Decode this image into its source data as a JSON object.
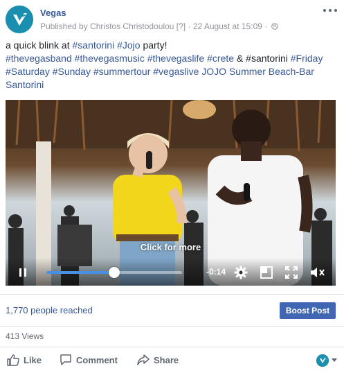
{
  "post": {
    "page_name": "Vegas",
    "published_prefix": "Published by",
    "author": "Christos Christodoulou",
    "author_badge": "[?]",
    "separator": "·",
    "date": "22 August at 15:09",
    "privacy_icon": "globe-icon",
    "text_parts": [
      {
        "text": "a quick blink at ",
        "tag": false
      },
      {
        "text": "#santorini",
        "tag": true
      },
      {
        "text": " ",
        "tag": false
      },
      {
        "text": "#Jojo",
        "tag": true
      },
      {
        "text": " party!",
        "tag": false
      },
      {
        "text": "\n",
        "tag": false
      },
      {
        "text": "#thevegasband",
        "tag": true
      },
      {
        "text": " ",
        "tag": false
      },
      {
        "text": "#thevegasmusic",
        "tag": true
      },
      {
        "text": " ",
        "tag": false
      },
      {
        "text": "#thevegaslife",
        "tag": true
      },
      {
        "text": " ",
        "tag": false
      },
      {
        "text": "#crete",
        "tag": true
      },
      {
        "text": " & #santorini ",
        "tag": false
      },
      {
        "text": "#Friday",
        "tag": true
      },
      {
        "text": " ",
        "tag": false
      },
      {
        "text": "#Saturday",
        "tag": true
      },
      {
        "text": " ",
        "tag": false
      },
      {
        "text": "#Sunday",
        "tag": true
      },
      {
        "text": " ",
        "tag": false
      },
      {
        "text": "#summertour",
        "tag": true
      },
      {
        "text": " ",
        "tag": false
      },
      {
        "text": "#vegaslive",
        "tag": true
      },
      {
        "text": " ",
        "tag": false
      },
      {
        "text": "JOJO Summer Beach-Bar Santorini",
        "tag": true
      }
    ]
  },
  "video": {
    "overlay_text": "Click for more",
    "time_remaining": "-0:14",
    "progress_fraction": 0.5,
    "progress_color": "#4a90e2",
    "icons": [
      "pause-icon",
      "settings-gear-icon",
      "picture-in-picture-icon",
      "fullscreen-icon",
      "mute-icon"
    ]
  },
  "stats": {
    "reach": "1,770 people reached",
    "boost_label": "Boost Post",
    "views": "413 Views"
  },
  "actions": {
    "like": "Like",
    "comment": "Comment",
    "share": "Share"
  },
  "colors": {
    "link_blue": "#365899",
    "boost_blue": "#4267b2",
    "brand_teal": "#1b8fb0"
  }
}
